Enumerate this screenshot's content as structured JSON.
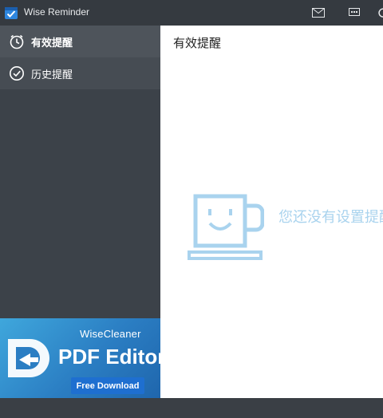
{
  "window": {
    "title": "Wise Reminder"
  },
  "titlebar": {
    "icons": [
      "mail-icon",
      "feedback-icon",
      "refresh-icon"
    ]
  },
  "sidebar": {
    "items": [
      {
        "label": "有效提醒",
        "icon": "clock-icon",
        "active": true
      },
      {
        "label": "历史提醒",
        "icon": "check-circle-icon",
        "active": false
      }
    ]
  },
  "ad": {
    "brand": "WiseCleaner",
    "product": "PDF Editor",
    "button": "Free Download"
  },
  "main": {
    "title": "有效提醒",
    "empty_message": "您还没有设置提醒"
  },
  "colors": {
    "accent": "#2b7ec3",
    "illustration": "#a9d3ee"
  }
}
